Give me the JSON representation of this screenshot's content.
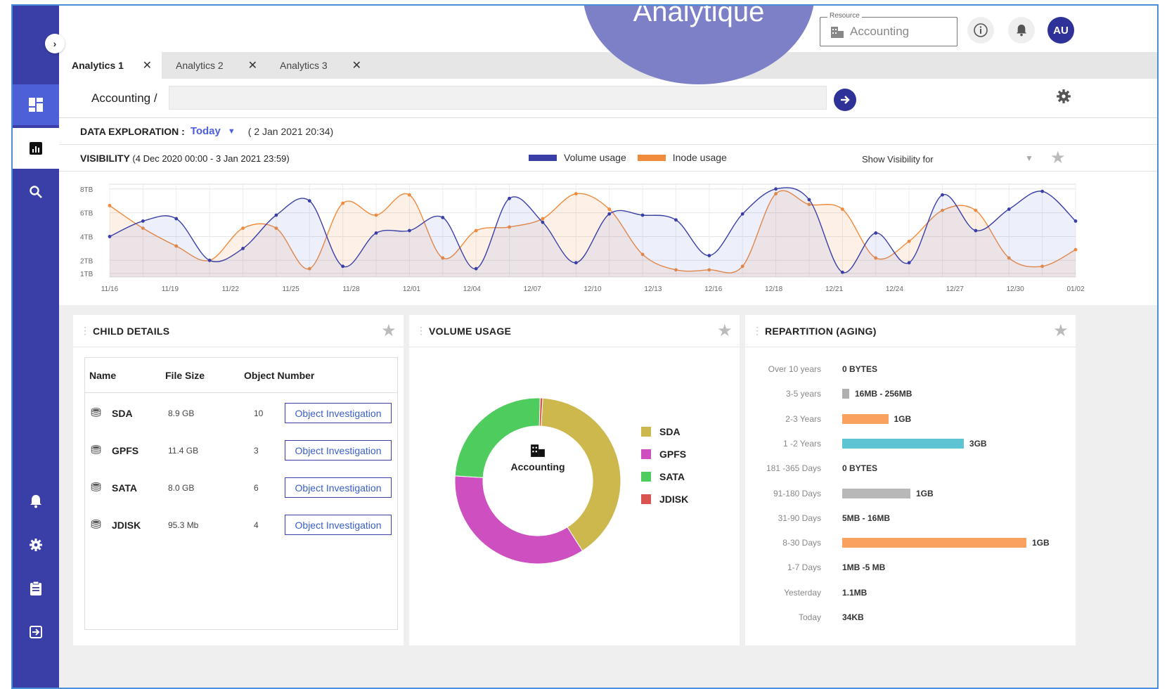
{
  "topbar": {
    "bubble_title": "Analytique",
    "resource": {
      "legend": "Resource",
      "value": "Accounting"
    },
    "info_icon": "info-icon",
    "bell_icon": "bell-icon",
    "avatar": "AU"
  },
  "tabs": [
    {
      "label": "Analytics 1",
      "active": true
    },
    {
      "label": "Analytics 2",
      "active": false
    },
    {
      "label": "Analytics 3",
      "active": false
    }
  ],
  "path": {
    "label": "Accounting /",
    "value": ""
  },
  "exploration": {
    "label": "DATA EXPLORATION :",
    "period": "Today",
    "date": "( 2 Jan 2021 20:34)"
  },
  "visibility": {
    "label": "VISIBILITY",
    "range": "(4 Dec 2020 00:00 - 3 Jan 2021 23:59)",
    "show_for": "Show Visibility for"
  },
  "chart_data": {
    "type": "line",
    "y_tick_labels": [
      "8TB",
      "6TB",
      "4TB",
      "2TB",
      "1TB"
    ],
    "x_tick_labels": [
      "11/16",
      "11/19",
      "11/22",
      "11/25",
      "11/28",
      "12/01",
      "12/04",
      "12/07",
      "12/10",
      "12/13",
      "12/16",
      "12/18",
      "12/21",
      "12/24",
      "12/27",
      "12/30",
      "01/02"
    ],
    "series": [
      {
        "name": "Volume usage",
        "color": "#3a3fa8",
        "values": [
          4.0,
          5.3,
          5.5,
          2.0,
          3.0,
          5.8,
          7.0,
          1.5,
          4.3,
          4.5,
          5.6,
          1.3,
          7.2,
          5.2,
          1.8,
          5.9,
          5.8,
          5.4,
          2.4,
          5.9,
          8.0,
          7.1,
          1.0,
          4.3,
          1.8,
          7.5,
          4.5,
          6.3,
          7.8,
          5.3
        ]
      },
      {
        "name": "Inode usage",
        "color": "#f08a3c",
        "values": [
          6.6,
          4.7,
          3.2,
          2.0,
          4.7,
          4.7,
          1.3,
          6.8,
          5.8,
          7.5,
          2.2,
          4.5,
          4.8,
          5.5,
          7.6,
          6.3,
          2.5,
          1.2,
          1.2,
          1.5,
          7.6,
          6.7,
          6.3,
          2.2,
          3.6,
          6.2,
          6.2,
          2.2,
          1.5,
          2.9
        ]
      }
    ]
  },
  "child_details": {
    "title": "CHILD DETAILS",
    "headers": [
      "Name",
      "File Size",
      "Object Number"
    ],
    "rows": [
      {
        "name": "SDA",
        "size": "8.9 GB",
        "count": "10",
        "action": "Object Investigation"
      },
      {
        "name": "GPFS",
        "size": "11.4 GB",
        "count": "3",
        "action": "Object Investigation"
      },
      {
        "name": "SATA",
        "size": "8.0 GB",
        "count": "6",
        "action": "Object Investigation"
      },
      {
        "name": "JDISK",
        "size": "95.3 Mb",
        "count": "4",
        "action": "Object Investigation"
      }
    ]
  },
  "volume_usage": {
    "title": "VOLUME USAGE",
    "center": "Accounting",
    "slices": [
      {
        "name": "SDA",
        "color": "#cdb84e",
        "fraction": 0.4
      },
      {
        "name": "GPFS",
        "color": "#cd4fc0",
        "fraction": 0.35
      },
      {
        "name": "SATA",
        "color": "#4fcc5e",
        "fraction": 0.245
      },
      {
        "name": "JDISK",
        "color": "#d9534f",
        "fraction": 0.005
      }
    ]
  },
  "repartition": {
    "title": "REPARTITION (AGING)",
    "rows": [
      {
        "label": "Over 10 years",
        "value": "0 BYTES",
        "bar": 0,
        "color": ""
      },
      {
        "label": "3-5 years",
        "value": "16MB - 256MB",
        "bar": 0.03,
        "color": "#b0b0b0"
      },
      {
        "label": "2-3 Years",
        "value": "1GB",
        "bar": 0.25,
        "color": "#f9a15f"
      },
      {
        "label": "1 -2 Years",
        "value": "3GB",
        "bar": 0.66,
        "color": "#5ec3d3"
      },
      {
        "label": "181 -365 Days",
        "value": "0 BYTES",
        "bar": 0,
        "color": ""
      },
      {
        "label": "91-180 Days",
        "value": "1GB",
        "bar": 0.37,
        "color": "#b8b8b8"
      },
      {
        "label": "31-90 Days",
        "value": "5MB - 16MB",
        "bar": 0,
        "color": ""
      },
      {
        "label": "8-30 Days",
        "value": "1GB",
        "bar": 1.0,
        "color": "#f9a15f"
      },
      {
        "label": "1-7 Days",
        "value": "1MB -5 MB",
        "bar": 0,
        "color": ""
      },
      {
        "label": "Yesterday",
        "value": "1.1MB",
        "bar": 0,
        "color": ""
      },
      {
        "label": "Today",
        "value": "34KB",
        "bar": 0,
        "color": ""
      }
    ]
  }
}
